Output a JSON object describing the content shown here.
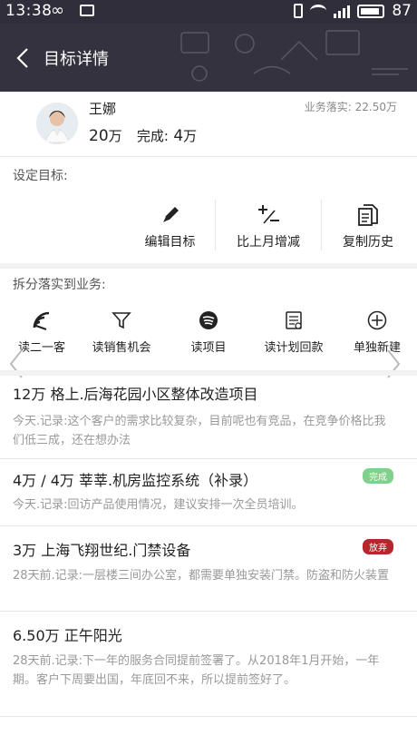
{
  "status_bar": {
    "time": "13:38",
    "infinity": "∞",
    "network": "4G",
    "battery": "87"
  },
  "header": {
    "title": "目标详情"
  },
  "profile": {
    "name": "王娜",
    "target": "20",
    "target_unit": "万",
    "completed_label": "完成:",
    "completed": "4",
    "completed_unit": "万",
    "business_amount": "业务落实: 22.50万"
  },
  "set_target": {
    "label": "设定目标:",
    "actions": [
      {
        "label": "编辑目标",
        "icon": "pencil-icon"
      },
      {
        "label": "比上月增减",
        "icon": "plus-minus-icon"
      },
      {
        "label": "复制历史",
        "icon": "copy-icon"
      }
    ]
  },
  "split": {
    "label": "拆分落实到业务:",
    "items": [
      {
        "label": "读二一客",
        "icon": "rss-icon"
      },
      {
        "label": "读销售机会",
        "icon": "filter-icon"
      },
      {
        "label": "读项目",
        "icon": "spotify-icon"
      },
      {
        "label": "读计划回款",
        "icon": "report-icon"
      },
      {
        "label": "单独新建",
        "icon": "plus-circle-icon"
      }
    ]
  },
  "records": [
    {
      "title": "12万 格上.后海花园小区整体改造项目",
      "note": "今天.记录:这个客户的需求比较复杂，目前呢也有竞品，在竞争价格比我们低三成，还在想办法"
    },
    {
      "title": "4万 / 4万 莘莘.机房监控系统（补录）",
      "note": "今天.记录:回访产品使用情况，建议安排一次全员培训。",
      "badge": "完成"
    },
    {
      "title": "3万 上海飞翔世纪.门禁设备",
      "note": "28天前.记录:一层楼三间办公室，都需要单独安装门禁。防盗和防火装置",
      "badge": "放弃"
    },
    {
      "title": "6.50万 正午阳光",
      "note": "28天前.记录:下一年的服务合同提前签署了。从2018年1月开始，一年期。客户下周要出国，年底回不来，所以提前签好了。"
    }
  ],
  "colors": {
    "header_bg": "#35323f",
    "done_badge": "#7ed08a",
    "drop_badge": "#b6262c"
  }
}
